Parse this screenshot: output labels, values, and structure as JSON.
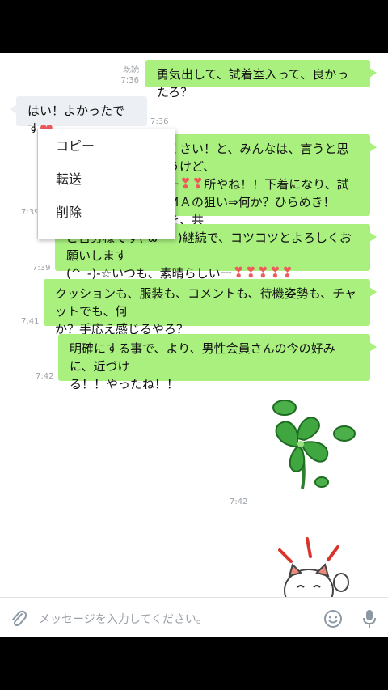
{
  "messages": [
    {
      "status": "既読",
      "time": "7:36",
      "text": "勇気出して、試着室入って、良かったろ？"
    },
    {
      "text": "はい！よかったです",
      "time": "7:36"
    },
    {
      "text_line1": "くさい！と、みんなは、言うと思うけど、",
      "text_line2_a": "ー",
      "text_line2_b": "所やね！！下着になり、試",
      "text_line3": "ＭＡの狙い⇒何か？ひらめき！を、共",
      "text_line4": "！！",
      "time": "7:39"
    },
    {
      "text_line1": "ご苦労様です( ω ・ )継続で、コツコツとよろしくお願いします",
      "text_line2": "(^_-)-☆いつも、素晴らしいー",
      "time": "7:39"
    },
    {
      "text_line1": "クッションも、服装も、コメントも、待機姿勢も、チャットでも、何",
      "text_line2": "か？手応え感じるやろ？",
      "time": "7:41"
    },
    {
      "text_line1": "明確にする事で、より、男性会員さんの今の好みに、近づけ",
      "text_line2": "る！！やったね！！",
      "time": "7:42"
    }
  ],
  "sticker_time": "7:42",
  "context_menu": {
    "items": [
      "コピー",
      "転送",
      "削除"
    ]
  },
  "input": {
    "placeholder": "メッセージを入力してください。"
  },
  "icons": {
    "attach": "paperclip-icon",
    "emoji": "smiley-icon",
    "mic": "microphone-icon"
  },
  "colors": {
    "outgoing_bubble": "#a9f07f",
    "incoming_bubble": "#eceff3",
    "heart": "#ef5a5a"
  }
}
